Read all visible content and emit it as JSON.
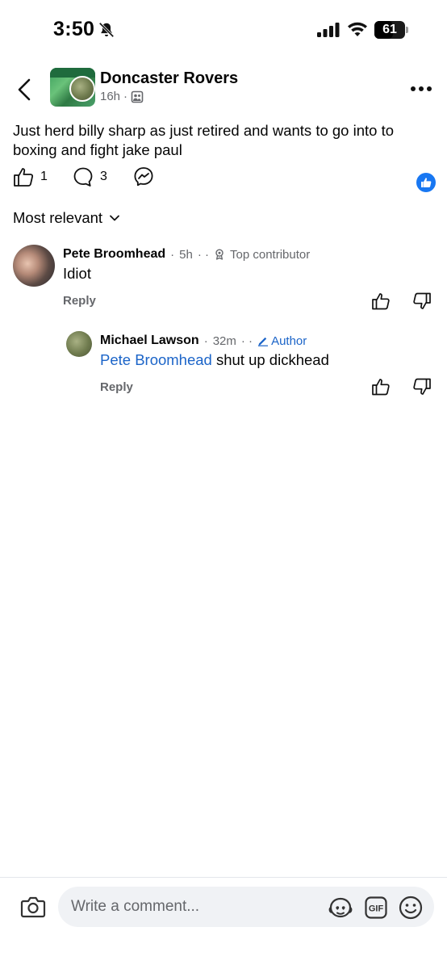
{
  "status_bar": {
    "time": "3:50",
    "battery_level": "61",
    "icons": [
      "bell-off-icon",
      "signal-icon",
      "wifi-icon",
      "battery-icon"
    ]
  },
  "header": {
    "group_name": "Doncaster Rovers",
    "post_age": "16h",
    "separator": "·",
    "icons": [
      "back-icon",
      "group-icon",
      "more-icon"
    ]
  },
  "post": {
    "text": "Just herd billy sharp as just retired and wants to go into to boxing and fight jake paul",
    "like_count": "1",
    "comment_count": "3",
    "reaction": "like"
  },
  "sort": {
    "label": "Most relevant"
  },
  "comments": [
    {
      "author": "Pete Broomhead",
      "age": "5h",
      "dots": "· ·",
      "badge": "Top contributor",
      "text": "Idiot",
      "reply_label": "Reply"
    },
    {
      "author": "Michael Lawson",
      "age": "32m",
      "dots": "· ·",
      "badge": "Author",
      "mention": "Pete Broomhead",
      "text": "shut up dickhead",
      "reply_label": "Reply"
    }
  ],
  "composer": {
    "placeholder": "Write a comment...",
    "gif_label": "GIF"
  },
  "colors": {
    "accent": "#1877f2",
    "link": "#1b64c8",
    "secondary_text": "#65676b",
    "field_bg": "#f0f2f5"
  }
}
